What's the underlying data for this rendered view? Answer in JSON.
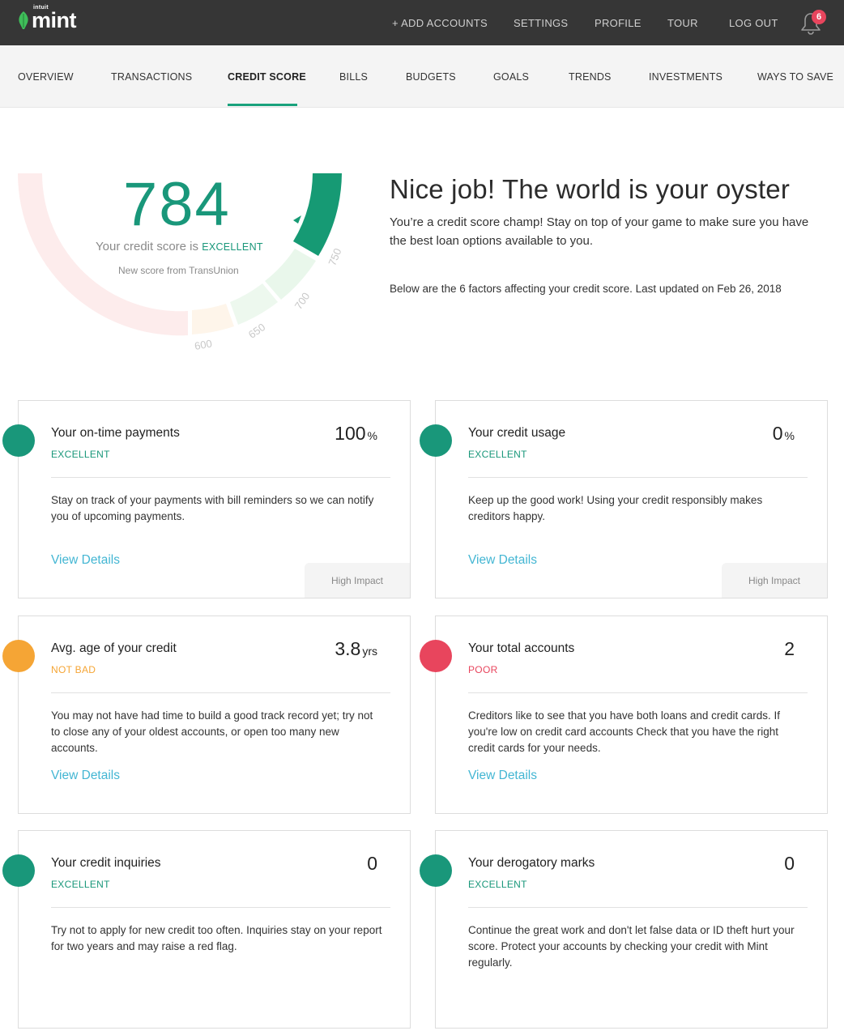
{
  "header": {
    "logo_small": "intuit",
    "logo": "mint",
    "nav": [
      "+ ADD ACCOUNTS",
      "SETTINGS",
      "PROFILE",
      "TOUR",
      "LOG OUT"
    ],
    "notification_count": "6"
  },
  "tabs": [
    "OVERVIEW",
    "TRANSACTIONS",
    "CREDIT SCORE",
    "BILLS",
    "BUDGETS",
    "GOALS",
    "TRENDS",
    "INVESTMENTS",
    "WAYS TO SAVE"
  ],
  "active_tab": "CREDIT SCORE",
  "gauge": {
    "score": "784",
    "score_prefix": "Your credit score is",
    "score_rating": "EXCELLENT",
    "source": "New score from TransUnion",
    "ticks": [
      "600",
      "650",
      "700",
      "750"
    ]
  },
  "summary": {
    "headline": "Nice job! The world is your oyster",
    "text": "You’re a credit score champ! Stay on top of your game to make sure you have the best loan options available to you.",
    "factors_note": "Below are the 6 factors affecting your credit score. Last updated on Feb 26, 2018"
  },
  "colors": {
    "excellent": "#19977a",
    "not_bad": "#f5a535",
    "poor": "#e8455d",
    "link": "#43b6d3"
  },
  "cards": [
    {
      "title": "Your on-time payments",
      "rating": "EXCELLENT",
      "value": "100",
      "unit": "%",
      "body": "Stay on track of your payments with bill reminders so we can notify you of upcoming payments.",
      "link": "View Details",
      "impact": "High Impact"
    },
    {
      "title": "Your credit usage",
      "rating": "EXCELLENT",
      "value": "0",
      "unit": "%",
      "body": "Keep up the good work! Using your credit responsibly makes creditors happy.",
      "link": "View Details",
      "impact": "High Impact"
    },
    {
      "title": "Avg. age of your credit",
      "rating": "NOT BAD",
      "value": "3.8",
      "unit": "yrs",
      "body": "You may not have had time to build a good track record yet; try not to close any of your oldest accounts, or open too many new accounts.",
      "link": "View Details"
    },
    {
      "title": "Your total accounts",
      "rating": "POOR",
      "value": "2",
      "body": "Creditors like to see that you have both loans and credit cards. If you're low on credit card accounts Check that you have the right credit cards for your needs.",
      "link": "View Details"
    },
    {
      "title": "Your credit inquiries",
      "rating": "EXCELLENT",
      "value": "0",
      "body": "Try not to apply for new credit too often. Inquiries stay on your report for two years and may raise a red flag."
    },
    {
      "title": "Your derogatory marks",
      "rating": "EXCELLENT",
      "value": "0",
      "body": "Continue the great work and don't let false data or ID theft hurt your score. Protect your accounts by checking your credit with Mint regularly."
    }
  ]
}
